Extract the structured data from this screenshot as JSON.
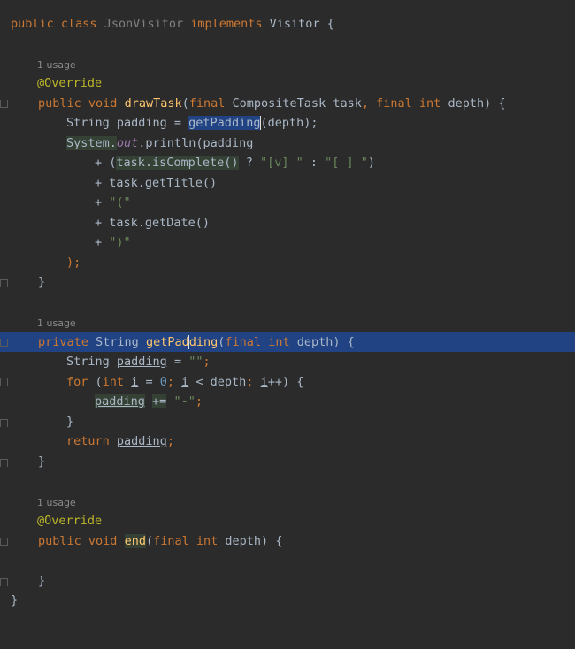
{
  "class_header": {
    "public": "public",
    "class": "class",
    "name": "JsonVisitor",
    "implements": "implements",
    "iface": "Visitor",
    "brace": "{"
  },
  "method1": {
    "usage_hint": "1 usage",
    "annotation": "@Override",
    "sig_public": "public",
    "sig_void": "void",
    "sig_name": "drawTask",
    "sig_paren_open": "(",
    "sig_final1": "final",
    "sig_param_type1": "CompositeTask task",
    "sig_comma": ",",
    "sig_final2": "final",
    "sig_int": "int",
    "sig_param2": "depth) {",
    "l1_type": "String padding = ",
    "l1_call": "getPadding",
    "l1_rest": "(depth);",
    "l2_sys": "System.",
    "l2_out": "out",
    "l2_rest": ".println(padding",
    "l3_plus": "+ (",
    "l3_task": "task.isComplete()",
    "l3_q": " ? ",
    "l3_s1": "\"[v] \"",
    "l3_colon": " : ",
    "l3_s2": "\"[ ] \"",
    "l3_close": ")",
    "l4": "+ task.getTitle()",
    "l5_plus": "+ ",
    "l5_str": "\"(\"",
    "l6": "+ task.getDate()",
    "l7_plus": "+ ",
    "l7_str": "\")\"",
    "l8": ");",
    "close": "}"
  },
  "method2": {
    "usage_hint": "1 usage",
    "sig_private": "private",
    "sig_type": "String",
    "sig_name_a": "getPad",
    "sig_name_b": "ding",
    "sig_paren": "(",
    "sig_final": "final",
    "sig_int": "int",
    "sig_param": "depth) {",
    "l1_type": "String ",
    "l1_var": "padding",
    "l1_eq": " = ",
    "l1_str": "\"\"",
    "l1_semi": ";",
    "l2_for": "for",
    "l2_open": " (",
    "l2_int": "int",
    "l2_i1": "i",
    "l2_eq": " = ",
    "l2_zero": "0",
    "l2_semi1": "; ",
    "l2_i2": "i",
    "l2_lt": " < depth",
    "l2_semi2": "; ",
    "l2_i3": "i",
    "l2_inc": "++) {",
    "l3_var": "padding",
    "l3_op": "+=",
    "l3_str": "\"-\"",
    "l3_semi": ";",
    "l4": "}",
    "l5_return": "return",
    "l5_var": "padding",
    "l5_semi": ";",
    "close": "}"
  },
  "method3": {
    "usage_hint": "1 usage",
    "annotation": "@Override",
    "sig_public": "public",
    "sig_void": "void",
    "sig_name": "end",
    "sig_paren": "(",
    "sig_final": "final",
    "sig_int": "int",
    "sig_param": "depth) {",
    "close": "}"
  },
  "class_close": "}",
  "colors": {
    "background": "#2b2b2b",
    "keyword": "#cc7832",
    "method": "#ffc66d",
    "annotation": "#bbb529",
    "string": "#6a8759",
    "number": "#6897bb",
    "field": "#9876aa",
    "current_line": "#214283"
  }
}
